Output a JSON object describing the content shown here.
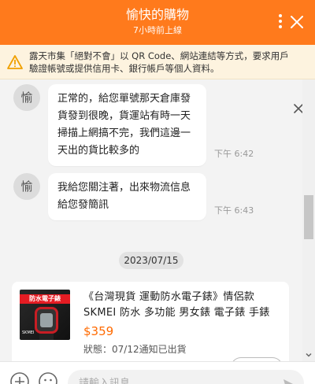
{
  "header": {
    "title": "愉快的購物",
    "status": "7小時前上線"
  },
  "warning": {
    "text": "露天市集「絕對不會」以 QR Code、網站連結等方式，要求用戶驗證帳號或提供信用卡、銀行帳戶等個人資料。"
  },
  "messages": [
    {
      "avatar": "愉",
      "text": "正常的，給您單號那天倉庫發貨發到很晚，貨運站有時一天掃描上網搞不完，我們這邊一天出的貨比較多的",
      "time": "下午 6:42"
    },
    {
      "avatar": "愉",
      "text": "我給您關注著，出來物流信息給您發簡訊",
      "time": "下午 6:43"
    }
  ],
  "date_divider": "2023/07/15",
  "product": {
    "name": "《台灣現貨 運動防水電子錶》情侶款 SKMEI 防水 多功能 男女錶 電子錶 手錶",
    "price": "$359",
    "status": "狀態：07/12通知已出貨",
    "image_banner": "防水電子錶",
    "image_brand": "SKMEI"
  },
  "composer": {
    "placeholder": "請輸入訊息"
  },
  "colors": {
    "brand": "#ff7a1c",
    "price": "#ff6a00",
    "warning_bg": "#fdf3df"
  }
}
